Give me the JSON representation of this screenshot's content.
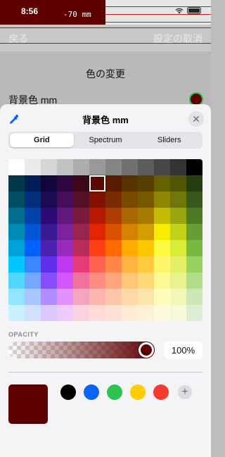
{
  "status_bar": {
    "time": "8:56",
    "mm_readout": "-70 mm",
    "icons": [
      "wifi-icon",
      "battery-icon"
    ]
  },
  "nav": {
    "back_label": "戻る",
    "cancel_label": "設定の取消"
  },
  "background_screen": {
    "section_title": "色の変更",
    "row_label": "背景色 mm"
  },
  "picker": {
    "title": "背景色 mm",
    "eyedropper_icon": "eyedropper-icon",
    "close_icon": "close-icon",
    "tabs": [
      {
        "label": "Grid",
        "active": true
      },
      {
        "label": "Spectrum",
        "active": false
      },
      {
        "label": "Sliders",
        "active": false
      }
    ],
    "selected_color": "#5e0000",
    "opacity_label": "OPACITY",
    "opacity_value": "100%",
    "opacity_level": 1.0,
    "presets": [
      {
        "name": "black",
        "color": "#000000"
      },
      {
        "name": "blue",
        "color": "#0a63f5"
      },
      {
        "name": "green",
        "color": "#2ec24f"
      },
      {
        "name": "yellow",
        "color": "#ffcc00"
      },
      {
        "name": "red",
        "color": "#f53b30"
      }
    ],
    "add_preset_icon": "plus-icon",
    "grid_colors": [
      [
        "#ffffff",
        "#ebebeb",
        "#d6d6d6",
        "#c2c2c2",
        "#adadad",
        "#999999",
        "#858585",
        "#707070",
        "#5c5c5c",
        "#474747",
        "#333333",
        "#000000"
      ],
      [
        "#00374a",
        "#011d57",
        "#11053b",
        "#2e063d",
        "#3c071b",
        "#5c0701",
        "#5a1c00",
        "#583300",
        "#563d00",
        "#666100",
        "#4f5504",
        "#263e0f"
      ],
      [
        "#004d65",
        "#012f7b",
        "#1a0a52",
        "#450d59",
        "#551029",
        "#831100",
        "#7b2900",
        "#7a4a00",
        "#785800",
        "#8c8602",
        "#6f760a",
        "#38571a"
      ],
      [
        "#016e8f",
        "#0042a9",
        "#2c0977",
        "#61187c",
        "#791a3d",
        "#b51a00",
        "#ad3e00",
        "#a96800",
        "#a67b01",
        "#c4bc00",
        "#9ba50e",
        "#4e7a27"
      ],
      [
        "#008cb4",
        "#0056d6",
        "#371a94",
        "#7a219e",
        "#99244f",
        "#e22400",
        "#da5100",
        "#d38301",
        "#d19d01",
        "#f5ec00",
        "#c3d117",
        "#669d34"
      ],
      [
        "#00a1d8",
        "#0061fd",
        "#4d22b2",
        "#982abc",
        "#b92d5d",
        "#ff4015",
        "#ff6a00",
        "#ffab01",
        "#fcc700",
        "#fefb41",
        "#d9ec37",
        "#76bb40"
      ],
      [
        "#01c7fc",
        "#3a87fd",
        "#5e30eb",
        "#be38f3",
        "#e63b7a",
        "#fe6250",
        "#fe8648",
        "#feb43f",
        "#fecb3e",
        "#fff76b",
        "#e4ef65",
        "#96d35f"
      ],
      [
        "#52d6fc",
        "#74a7ff",
        "#864ffd",
        "#d357fe",
        "#ee719e",
        "#ff8c82",
        "#fea57d",
        "#fec777",
        "#fed977",
        "#fff994",
        "#eaf28f",
        "#b1dd8b"
      ],
      [
        "#93e3fc",
        "#a7c6ff",
        "#b18cfe",
        "#e292fe",
        "#f4a4c0",
        "#ffb5af",
        "#ffc5ab",
        "#fed9a8",
        "#fde4a8",
        "#fffbb9",
        "#f1f7b7",
        "#cde8b5"
      ],
      [
        "#cbf0ff",
        "#d2e2fe",
        "#d8c9fe",
        "#efcafe",
        "#f9d3e0",
        "#ffdad8",
        "#ffe2d6",
        "#feecd4",
        "#fef1d5",
        "#fdfbdd",
        "#f6fadb",
        "#deeed4"
      ]
    ]
  }
}
